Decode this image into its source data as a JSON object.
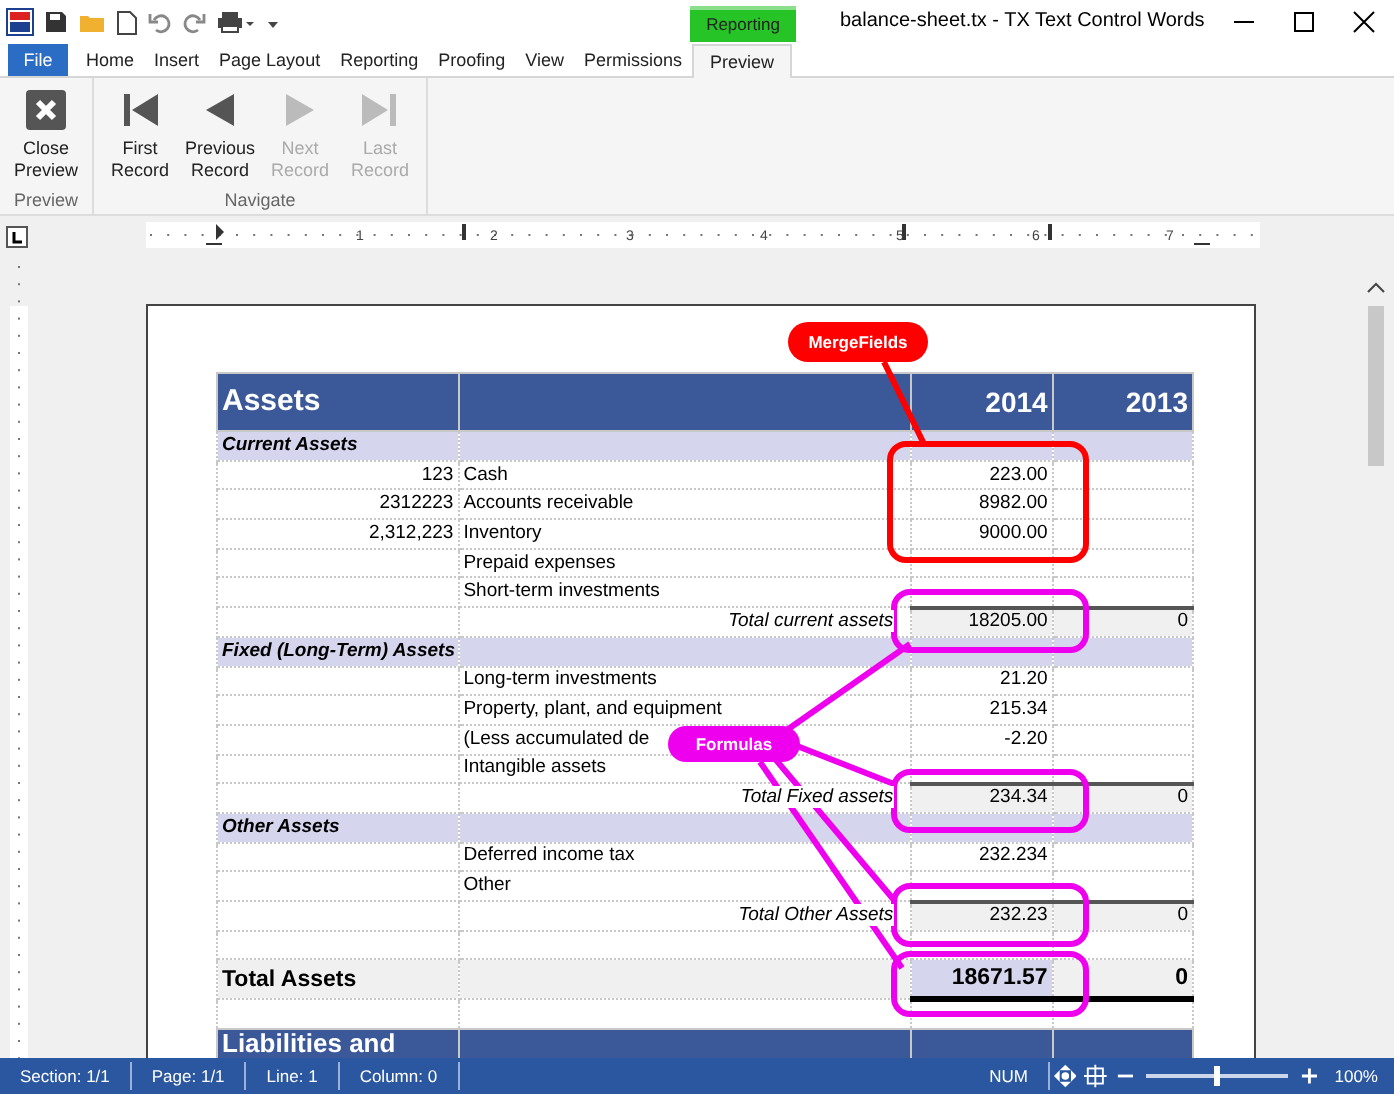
{
  "window": {
    "title": "balance-sheet.tx - TX Text Control Words"
  },
  "contextual_tab": {
    "label": "Reporting"
  },
  "file_tab": {
    "label": "File"
  },
  "tabs": [
    {
      "label": "Home",
      "selected": false
    },
    {
      "label": "Insert",
      "selected": false
    },
    {
      "label": "Page Layout",
      "selected": false
    },
    {
      "label": "Reporting",
      "selected": false
    },
    {
      "label": "Proofing",
      "selected": false
    },
    {
      "label": "View",
      "selected": false
    },
    {
      "label": "Permissions",
      "selected": false
    },
    {
      "label": "Preview",
      "selected": true
    }
  ],
  "ribbon_groups": [
    {
      "label": "Preview",
      "buttons": [
        {
          "kind": "close",
          "label": "Close Preview",
          "disabled": false
        }
      ]
    },
    {
      "label": "Navigate",
      "buttons": [
        {
          "kind": "first",
          "label": "First Record",
          "disabled": false
        },
        {
          "kind": "previous",
          "label": "Previous Record",
          "disabled": false
        },
        {
          "kind": "next",
          "label": "Next Record",
          "disabled": true
        },
        {
          "kind": "last",
          "label": "Last Record",
          "disabled": true
        }
      ]
    }
  ],
  "ruler": {
    "numbers": [
      "1",
      "2",
      "3",
      "4",
      "5",
      "6",
      "7"
    ]
  },
  "table": {
    "rows": [
      {
        "kind": "heading",
        "label": "Assets",
        "amount": "2014",
        "prior_amount": "2013"
      },
      {
        "kind": "section",
        "label": "Current Assets"
      },
      {
        "kind": "item",
        "number": "123",
        "label": "Cash",
        "amount": "223.00"
      },
      {
        "kind": "item",
        "number": "2312223",
        "label": "Accounts receivable",
        "amount": "8982.00"
      },
      {
        "kind": "item",
        "number": "2,312,223",
        "label": "Inventory",
        "amount": "9000.00"
      },
      {
        "kind": "item",
        "label": "Prepaid expenses"
      },
      {
        "kind": "item",
        "label": "Short-term investments"
      },
      {
        "kind": "total",
        "label": "Total current assets",
        "amount": "18205.00",
        "prior_amount": "0"
      },
      {
        "kind": "section",
        "label": "Fixed (Long-Term) Assets"
      },
      {
        "kind": "item",
        "label": "Long-term investments",
        "amount": "21.20"
      },
      {
        "kind": "item",
        "label": "Property, plant, and equipment",
        "amount": "215.34"
      },
      {
        "kind": "item",
        "label": "(Less accumulated de",
        "amount": "-2.20"
      },
      {
        "kind": "item",
        "label": "Intangible assets"
      },
      {
        "kind": "total",
        "label": "Total Fixed assets",
        "amount": "234.34",
        "prior_amount": "0"
      },
      {
        "kind": "section",
        "label": "Other Assets"
      },
      {
        "kind": "item",
        "label": "Deferred income tax",
        "amount": "232.234"
      },
      {
        "kind": "item",
        "label": "Other"
      },
      {
        "kind": "total",
        "label": "Total Other Assets",
        "amount": "232.23",
        "prior_amount": "0"
      },
      {
        "kind": "blank"
      },
      {
        "kind": "grand",
        "label": "Total Assets",
        "amount": "18671.57",
        "prior_amount": "0"
      },
      {
        "kind": "blank"
      },
      {
        "kind": "heading",
        "label": "Liabilities and"
      }
    ]
  },
  "callouts": [
    {
      "kind": "mergefield",
      "label": "MergeFields",
      "color": "#ff0000"
    },
    {
      "kind": "formula",
      "label": "Formulas",
      "color": "#ee00ee"
    }
  ],
  "status_bar": {
    "fields": [
      "Section: 1/1",
      "Page: 1/1",
      "Line: 1",
      "Column: 0"
    ],
    "num": "NUM",
    "zoom": "100%",
    "zoom_slider": {
      "level": 0.5
    }
  }
}
